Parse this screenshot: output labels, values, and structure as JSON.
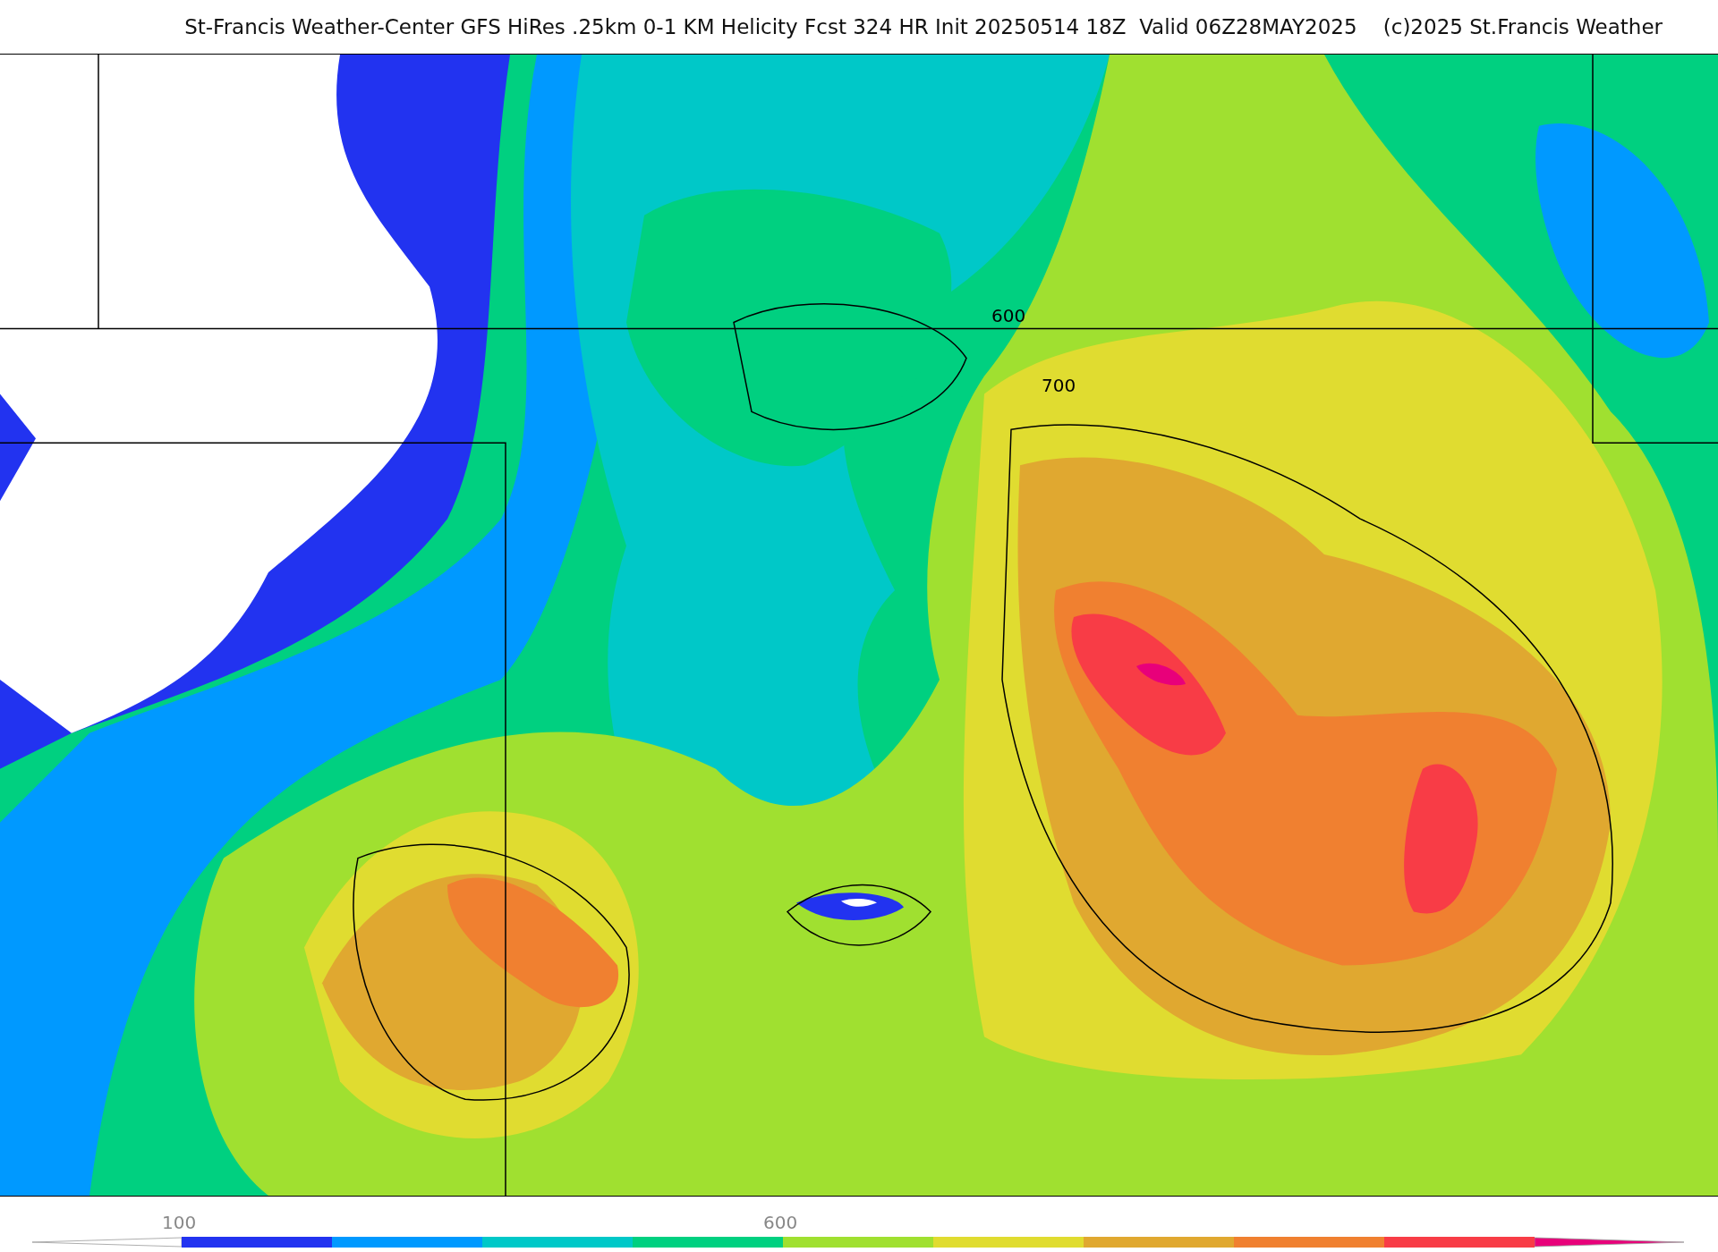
{
  "title": "St-Francis Weather-Center GFS HiRes .25km 0-1 KM Helicity Fcst 324 HR Init 20250514 18Z  Valid 06Z28MAY2025    (c)2025 St.Francis Weather",
  "map": {
    "contour_labels": [
      "600",
      "700"
    ]
  },
  "colorbar": {
    "segments": [
      {
        "kind": "low_end",
        "color": "#ffffff"
      },
      {
        "color": "#2233f0",
        "label": "100"
      },
      {
        "color": "#0099ff"
      },
      {
        "color": "#00c8c8"
      },
      {
        "color": "#00d080"
      },
      {
        "color": "#a0e030",
        "label": "600"
      },
      {
        "color": "#e0dc30"
      },
      {
        "color": "#e0a830"
      },
      {
        "color": "#f08030"
      },
      {
        "color": "#f83c46"
      },
      {
        "kind": "high_end",
        "color": "#e8007a"
      }
    ]
  }
}
